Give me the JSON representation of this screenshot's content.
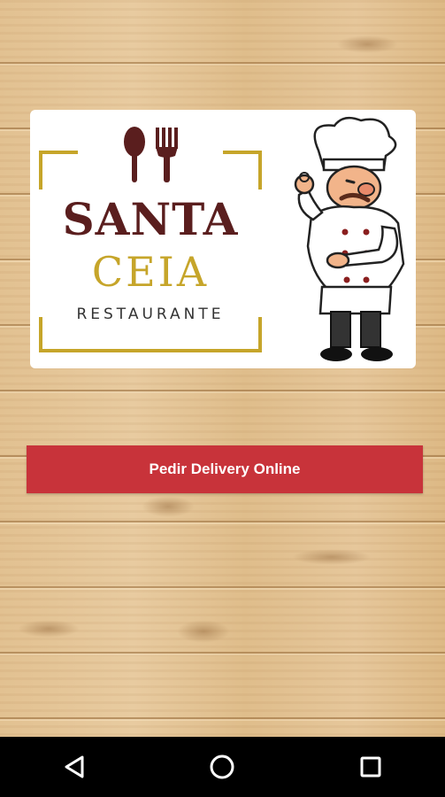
{
  "logo": {
    "line1": "SANTA",
    "line2": "CEIA",
    "line3": "RESTAURANTE",
    "colors": {
      "maroon": "#5a1e1e",
      "gold": "#c6a52a"
    },
    "icons": [
      "spoon-icon",
      "fork-icon",
      "chef-illustration"
    ]
  },
  "actions": {
    "delivery_button_label": "Pedir Delivery Online",
    "delivery_button_color": "#c8333a"
  },
  "navigation_bar": {
    "items": [
      "back-icon",
      "home-icon",
      "recents-icon"
    ]
  }
}
